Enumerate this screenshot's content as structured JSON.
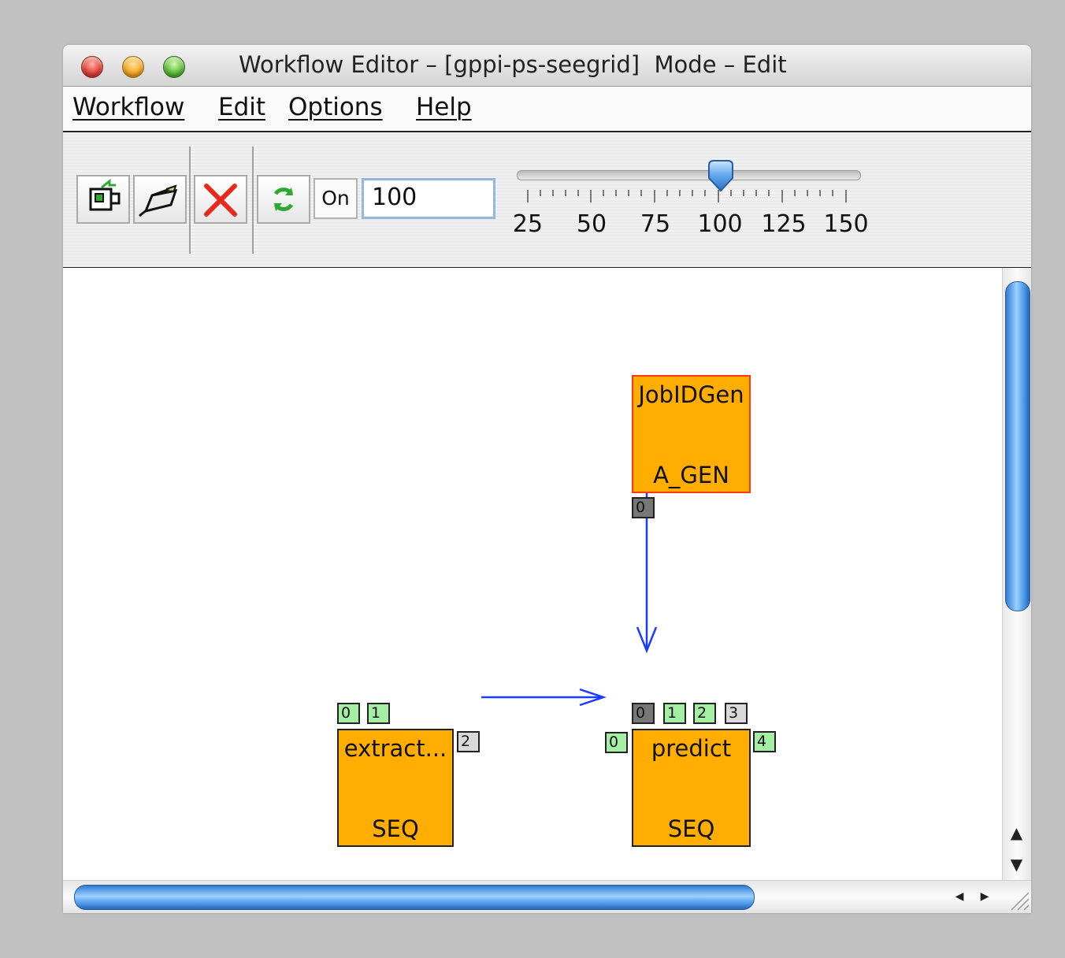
{
  "window": {
    "title": "Workflow Editor – [gppi-ps-seegrid]  Mode – Edit"
  },
  "menubar": {
    "items": [
      {
        "label": "Workflow"
      },
      {
        "label": "Edit"
      },
      {
        "label": "Options"
      },
      {
        "label": "Help"
      }
    ]
  },
  "toolbar": {
    "buttons": [
      {
        "icon": "new-workflow-icon"
      },
      {
        "icon": "connect-plug-icon"
      },
      {
        "icon": "delete-x-icon",
        "color": "#e8281c"
      },
      {
        "icon": "refresh-arrows-icon",
        "color": "#2ea82e"
      }
    ],
    "on_label": "On",
    "zoom_value": "100",
    "slider": {
      "min": 25,
      "max": 150,
      "value": 100,
      "tick_labels": [
        "25",
        "50",
        "75",
        "100",
        "125",
        "150"
      ]
    }
  },
  "graph": {
    "nodes": [
      {
        "id": "jobidgen",
        "name": "JobIDGen",
        "type": "A_GEN",
        "selected": true,
        "color": "#ffae00",
        "ports_out": [
          {
            "label": "0",
            "style": "dark"
          }
        ]
      },
      {
        "id": "extract",
        "name": "extract...",
        "type": "SEQ",
        "color": "#ffae00",
        "ports_in": [
          {
            "label": "0",
            "style": "green"
          },
          {
            "label": "1",
            "style": "green"
          }
        ],
        "ports_out": [
          {
            "label": "2",
            "style": "gray"
          }
        ]
      },
      {
        "id": "predict",
        "name": "predict",
        "type": "SEQ",
        "color": "#ffae00",
        "ports_top": [
          {
            "label": "0",
            "style": "dark"
          },
          {
            "label": "1",
            "style": "green"
          },
          {
            "label": "2",
            "style": "green"
          },
          {
            "label": "3",
            "style": "gray"
          }
        ],
        "ports_left": [
          {
            "label": "0",
            "style": "green"
          }
        ],
        "ports_right": [
          {
            "label": "4",
            "style": "green"
          }
        ]
      }
    ],
    "edge_color": "#1a3cff"
  },
  "colors": {
    "node_fill": "#ffae00",
    "selected_border": "#ff3a12",
    "scroll_thumb": "#4a9be8"
  }
}
